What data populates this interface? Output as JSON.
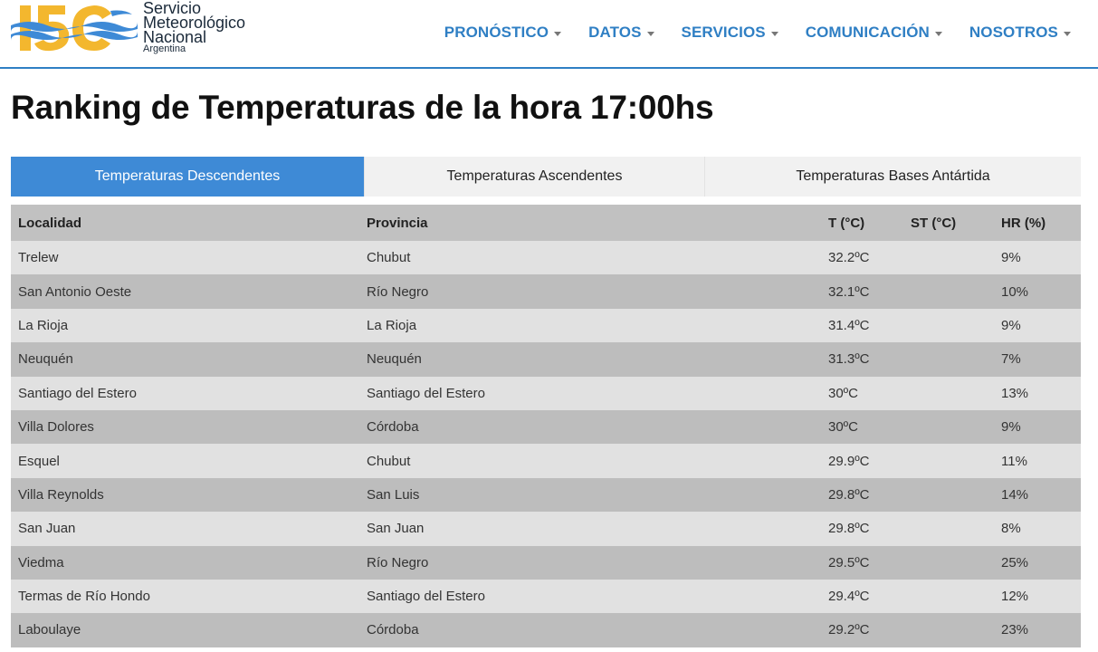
{
  "header": {
    "logo": {
      "number": "150",
      "line1": "Servicio",
      "line2": "Meteorológico",
      "line3": "Nacional",
      "line4": "Argentina",
      "accent_color": "#f3b72e",
      "wave_color": "#3e8ad6"
    },
    "nav": [
      {
        "label": "PRONÓSTICO"
      },
      {
        "label": "DATOS"
      },
      {
        "label": "SERVICIOS"
      },
      {
        "label": "COMUNICACIÓN"
      },
      {
        "label": "NOSOTROS"
      }
    ]
  },
  "title": "Ranking de Temperaturas de la hora 17:00hs",
  "tabs": [
    {
      "label": "Temperaturas Descendentes"
    },
    {
      "label": "Temperaturas Ascendentes"
    },
    {
      "label": "Temperaturas Bases Antártida"
    }
  ],
  "table": {
    "headers": [
      "Localidad",
      "Provincia",
      "T (°C)",
      "ST (°C)",
      "HR (%)"
    ],
    "rows": [
      {
        "localidad": "Trelew",
        "provincia": "Chubut",
        "t": "32.2ºC",
        "st": "",
        "hr": "9%"
      },
      {
        "localidad": "San Antonio Oeste",
        "provincia": "Río Negro",
        "t": "32.1ºC",
        "st": "",
        "hr": "10%"
      },
      {
        "localidad": "La Rioja",
        "provincia": "La Rioja",
        "t": "31.4ºC",
        "st": "",
        "hr": "9%"
      },
      {
        "localidad": "Neuquén",
        "provincia": "Neuquén",
        "t": "31.3ºC",
        "st": "",
        "hr": "7%"
      },
      {
        "localidad": "Santiago del Estero",
        "provincia": "Santiago del Estero",
        "t": "30ºC",
        "st": "",
        "hr": "13%"
      },
      {
        "localidad": "Villa Dolores",
        "provincia": "Córdoba",
        "t": "30ºC",
        "st": "",
        "hr": "9%"
      },
      {
        "localidad": "Esquel",
        "provincia": "Chubut",
        "t": "29.9ºC",
        "st": "",
        "hr": "11%"
      },
      {
        "localidad": "Villa Reynolds",
        "provincia": "San Luis",
        "t": "29.8ºC",
        "st": "",
        "hr": "14%"
      },
      {
        "localidad": "San Juan",
        "provincia": "San Juan",
        "t": "29.8ºC",
        "st": "",
        "hr": "8%"
      },
      {
        "localidad": "Viedma",
        "provincia": "Río Negro",
        "t": "29.5ºC",
        "st": "",
        "hr": "25%"
      },
      {
        "localidad": "Termas de Río Hondo",
        "provincia": "Santiago del Estero",
        "t": "29.4ºC",
        "st": "",
        "hr": "12%"
      },
      {
        "localidad": "Laboulaye",
        "provincia": "Córdoba",
        "t": "29.2ºC",
        "st": "",
        "hr": "23%"
      }
    ]
  }
}
